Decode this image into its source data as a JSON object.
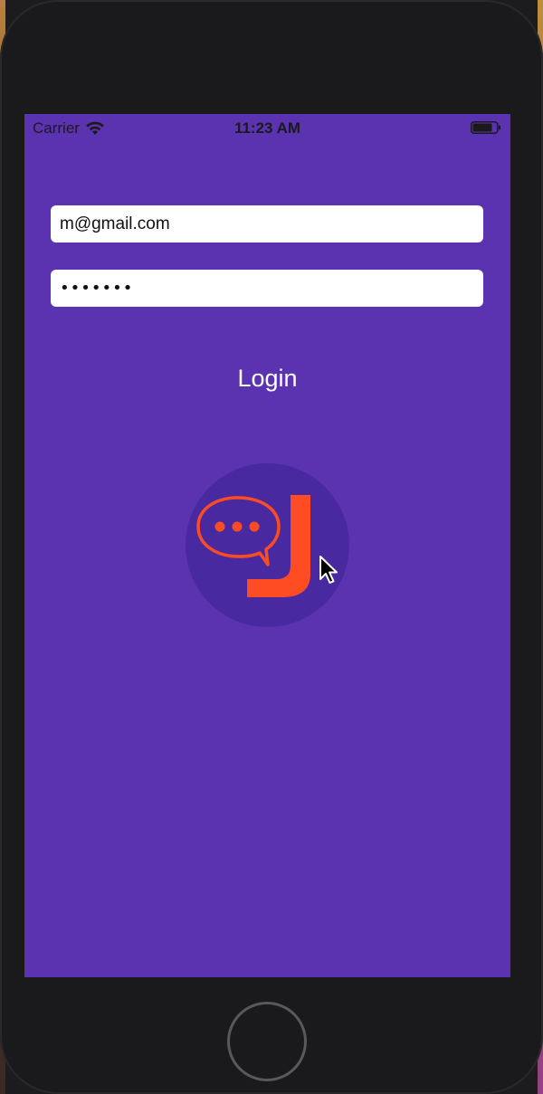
{
  "status_bar": {
    "carrier": "Carrier",
    "time": "11:23 AM",
    "wifi_icon": "wifi-icon",
    "battery_icon": "battery-icon"
  },
  "login_form": {
    "email_value": "m@gmail.com",
    "password_masked": "•••••••",
    "login_label": "Login"
  },
  "logo": {
    "icon": "chat-bubble-j-logo",
    "letter": "J",
    "accent_color": "#ff4c22",
    "circle_color": "#4829a0"
  },
  "colors": {
    "background": "#5b33b0",
    "field_background": "#ffffff",
    "device_frame": "#1a191b"
  }
}
